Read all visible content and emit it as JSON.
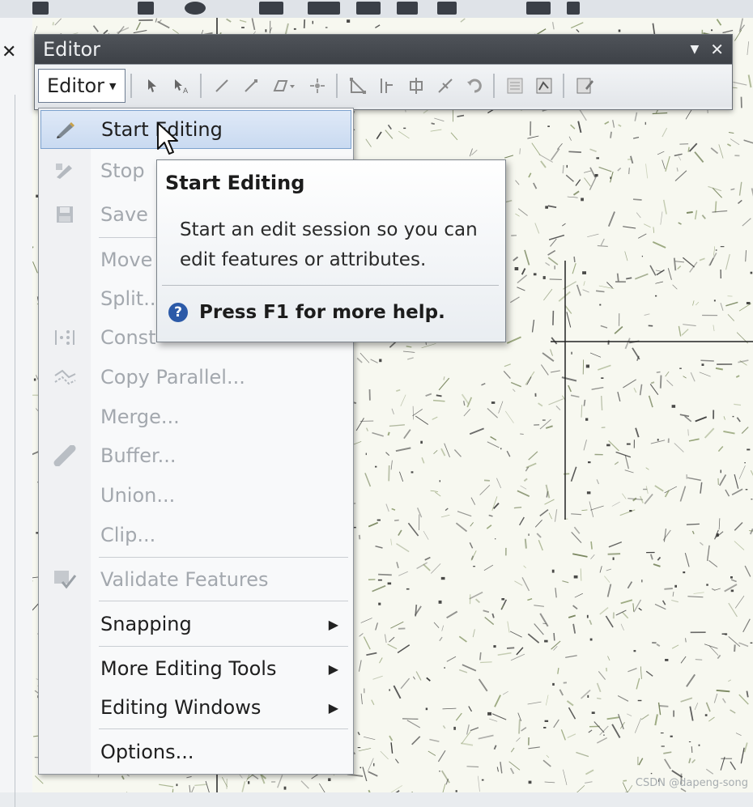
{
  "editor_toolbar": {
    "title": "Editor",
    "dropdown_label": "Editor",
    "title_controls": {
      "menu_glyph": "▼",
      "close_glyph": "✕"
    },
    "tool_icons": [
      "edit-tool-icon",
      "annotation-edit-tool-icon",
      "straight-segment-icon",
      "endpoint-arc-icon",
      "trace-tool-icon",
      "point-tool-icon",
      "edit-vertices-icon",
      "reshape-feature-icon",
      "cut-polygons-icon",
      "split-tool-icon",
      "rotate-tool-icon",
      "attributes-icon",
      "sketch-properties-icon",
      "create-features-icon"
    ]
  },
  "menu": {
    "items": [
      {
        "label": "Start Editing",
        "icon": "start-editing-icon",
        "enabled": true,
        "highlighted": true
      },
      {
        "label": "Stop",
        "icon": "stop-editing-icon",
        "enabled": false
      },
      {
        "label": "Save",
        "icon": "save-edits-icon",
        "enabled": false
      },
      {
        "label": "Move",
        "icon": "",
        "enabled": false
      },
      {
        "label": "Split...",
        "icon": "",
        "enabled": false
      },
      {
        "label": "Const",
        "icon": "construct-points-icon",
        "enabled": false
      },
      {
        "label": "Copy Parallel...",
        "icon": "copy-parallel-icon",
        "enabled": false
      },
      {
        "label": "Merge...",
        "icon": "",
        "enabled": false
      },
      {
        "label": "Buffer...",
        "icon": "buffer-icon",
        "enabled": false
      },
      {
        "label": "Union...",
        "icon": "",
        "enabled": false
      },
      {
        "label": "Clip...",
        "icon": "",
        "enabled": false
      },
      {
        "label": "Validate Features",
        "icon": "validate-features-icon",
        "enabled": false
      },
      {
        "label": "Snapping",
        "icon": "",
        "enabled": true,
        "submenu": true
      },
      {
        "label": "More Editing Tools",
        "icon": "",
        "enabled": true,
        "submenu": true
      },
      {
        "label": "Editing Windows",
        "icon": "",
        "enabled": true,
        "submenu": true
      },
      {
        "label": "Options...",
        "icon": "",
        "enabled": true
      }
    ]
  },
  "tooltip": {
    "title": "Start Editing",
    "description": "Start an edit session so you can edit features or attributes.",
    "help_text": "Press F1 for more help.",
    "help_icon": "?"
  },
  "watermark": "CSDN @dapeng-song",
  "colors": {
    "title_bar": "#44484e",
    "highlight": "#cfdef3",
    "disabled_text": "#a3a8ae"
  }
}
